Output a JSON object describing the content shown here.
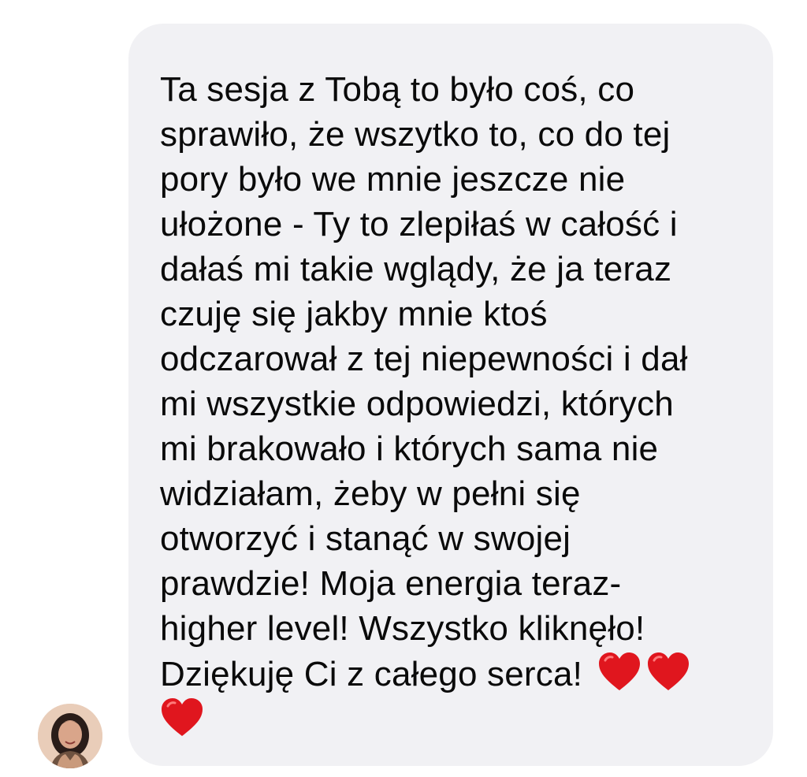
{
  "message": {
    "lines": [
      "Ta sesja z Tobą to było coś, co",
      "sprawiło, że wszytko to, co do tej",
      "pory było we mnie jeszcze nie",
      "ułożone - Ty to zlepiłaś w całość i",
      "dałaś mi takie wglądy, że ja teraz",
      "czuję się jakby mnie ktoś",
      "odczarował z tej niepewności i dał",
      "mi wszystkie odpowiedzi, których",
      "mi brakowało i których sama nie",
      "widziałam, żeby w pełni się",
      "otworzyć i stanąć w swojej",
      "prawdzie! Moja energia teraz-",
      "higher level! Wszystko kliknęło!",
      "Dziękuję Ci z całego serca!"
    ],
    "hearts": [
      "red-heart-icon",
      "red-heart-icon",
      "red-heart-icon"
    ]
  },
  "colors": {
    "bubble_background": "#f1f1f4",
    "text": "#0a0a0a",
    "heart": "#e0161e"
  },
  "sender": {
    "avatar_icon": "avatar-photo"
  }
}
